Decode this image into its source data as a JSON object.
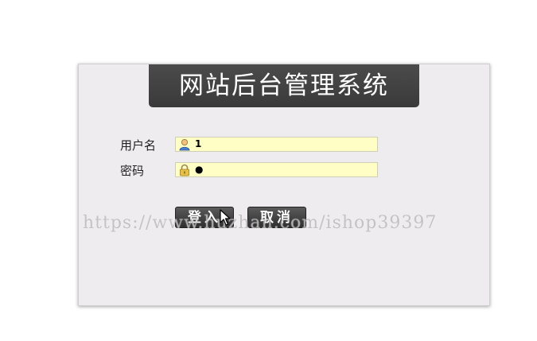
{
  "header": {
    "title": "网站后台管理系统"
  },
  "form": {
    "username_label": "用户名",
    "username_value": "1",
    "username_icon": "user-icon",
    "password_label": "密码",
    "password_value": "●",
    "password_icon": "lock-icon"
  },
  "buttons": {
    "login_label": "登入",
    "cancel_label": "取消"
  },
  "watermark": {
    "text": "https://www.huzhan.com/ishop39397"
  },
  "colors": {
    "panel_bg": "#efecef",
    "title_bg": "#434343",
    "input_bg": "#ffffc5",
    "button_bg": "#3f3f3f"
  }
}
